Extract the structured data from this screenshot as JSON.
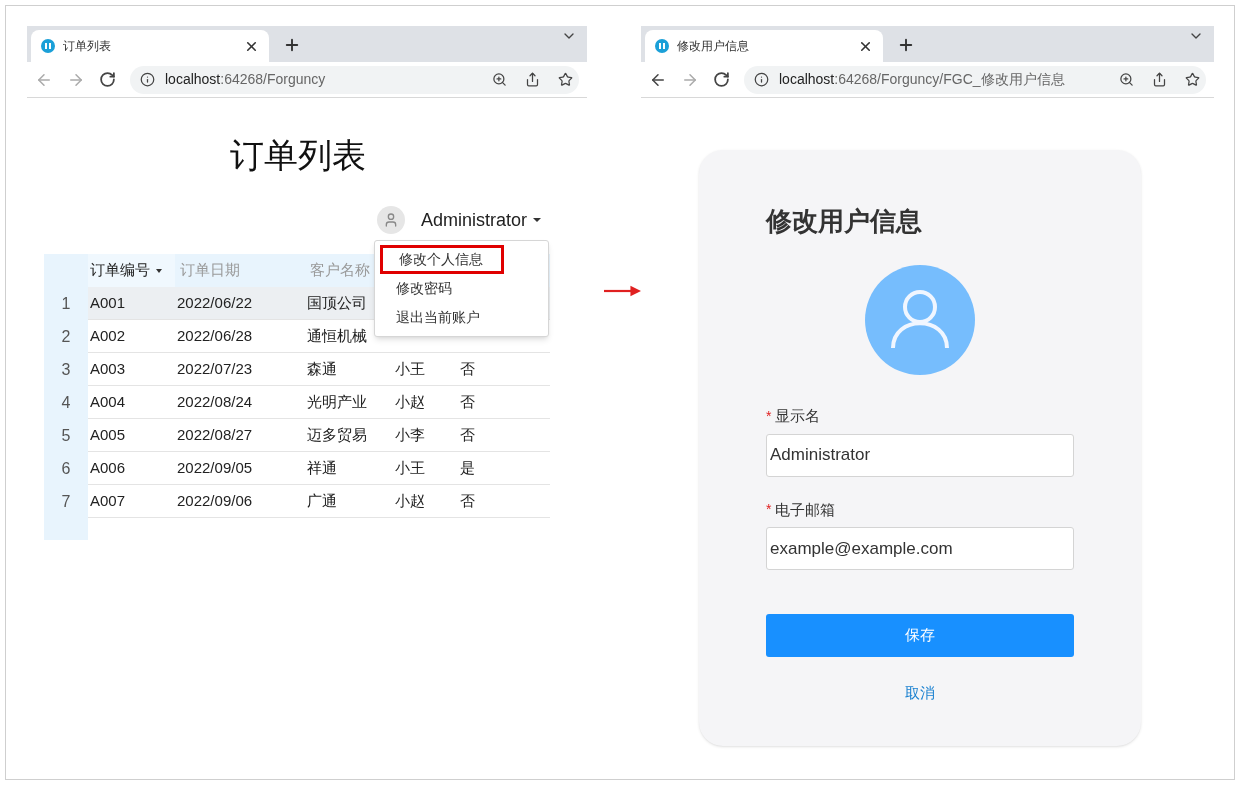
{
  "left_browser": {
    "tab": {
      "title": "订单列表"
    },
    "url": {
      "host": "localhost",
      "path": ":64268/Forguncy"
    },
    "back_enabled": false,
    "forward_enabled": false,
    "page": {
      "title": "订单列表",
      "user": {
        "name": "Administrator"
      },
      "table": {
        "columns": [
          {
            "label": "订单编号",
            "sorted": true
          },
          {
            "label": "订单日期",
            "sorted": false
          },
          {
            "label": "客户名称",
            "sorted": false
          }
        ],
        "rows": [
          {
            "number": "1",
            "selected": true,
            "cells": [
              "A001",
              "2022/06/22",
              "国顶公司"
            ]
          },
          {
            "number": "2",
            "selected": false,
            "cells": [
              "A002",
              "2022/06/28",
              "通恒机械"
            ]
          },
          {
            "number": "3",
            "selected": false,
            "cells": [
              "A003",
              "2022/07/23",
              "森通",
              "小王",
              "否"
            ]
          },
          {
            "number": "4",
            "selected": false,
            "cells": [
              "A004",
              "2022/08/24",
              "光明产业",
              "小赵",
              "否"
            ]
          },
          {
            "number": "5",
            "selected": false,
            "cells": [
              "A005",
              "2022/08/27",
              "迈多贸易",
              "小李",
              "否"
            ]
          },
          {
            "number": "6",
            "selected": false,
            "cells": [
              "A006",
              "2022/09/05",
              "祥通",
              "小王",
              "是"
            ]
          },
          {
            "number": "7",
            "selected": false,
            "cells": [
              "A007",
              "2022/09/06",
              "广通",
              "小赵",
              "否"
            ]
          }
        ]
      },
      "user_menu": {
        "items": [
          {
            "label": "修改个人信息",
            "highlighted": true
          },
          {
            "label": "修改密码",
            "highlighted": false
          },
          {
            "label": "退出当前账户",
            "highlighted": false
          }
        ]
      }
    }
  },
  "right_browser": {
    "tab": {
      "title": "修改用户信息"
    },
    "url": {
      "host": "localhost",
      "path": ":64268/Forguncy/FGC_修改用户信息"
    },
    "back_enabled": true,
    "forward_enabled": false,
    "page": {
      "heading": "修改用户信息",
      "fields": [
        {
          "required_mark": "*",
          "label": "显示名",
          "value": "Administrator"
        },
        {
          "required_mark": "*",
          "label": "电子邮箱",
          "value": "example@example.com"
        }
      ],
      "save_button": "保存",
      "cancel_link": "取消"
    }
  }
}
